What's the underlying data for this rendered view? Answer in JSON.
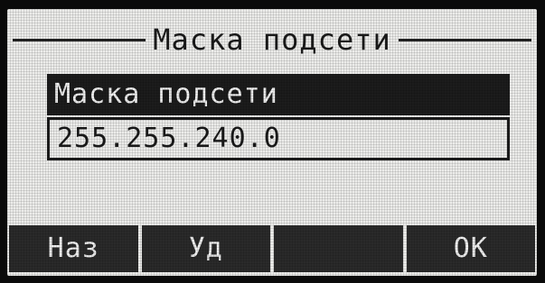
{
  "screen": {
    "title": "Маска подсети"
  },
  "field": {
    "label": "Маска подсети",
    "value": "255.255.240.0"
  },
  "softkeys": [
    {
      "label": "Наз"
    },
    {
      "label": "Уд"
    },
    {
      "label": ""
    },
    {
      "label": "OK"
    }
  ]
}
